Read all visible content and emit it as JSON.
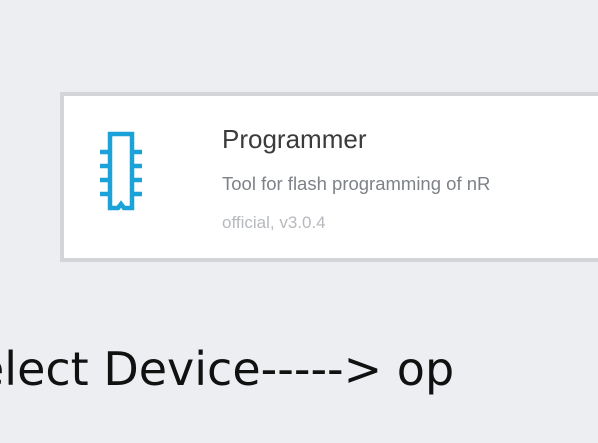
{
  "app_card": {
    "name": "Programmer",
    "description": "Tool for flash programming of nR",
    "meta": "official, v3.0.4",
    "icon": "chip-icon",
    "icon_color": "#1ba3d9"
  },
  "caption": {
    "text": "elect Device-----> op"
  }
}
